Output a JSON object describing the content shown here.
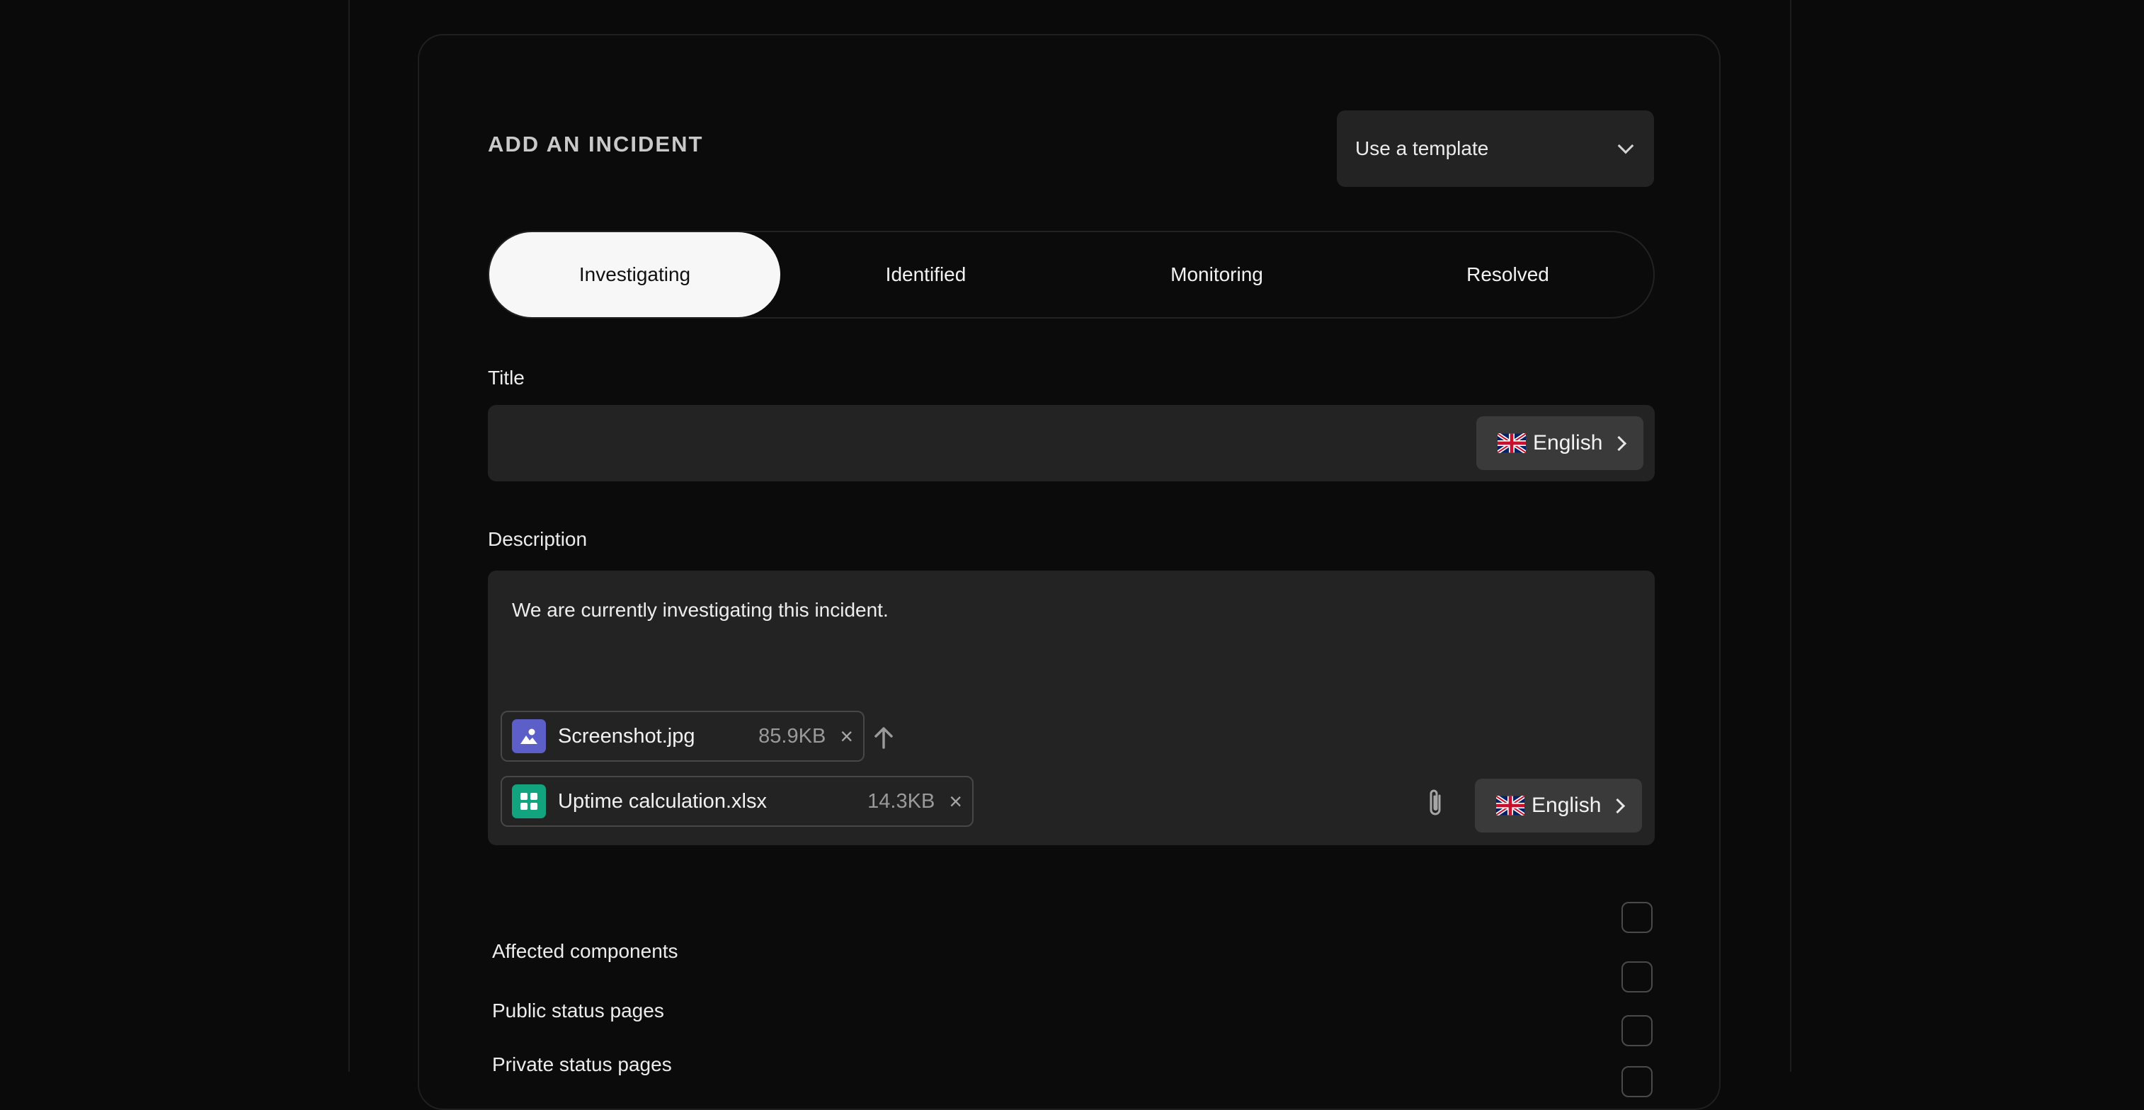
{
  "header": {
    "title": "ADD AN INCIDENT",
    "template_select_label": "Use a template"
  },
  "status_tabs": [
    {
      "label": "Investigating",
      "active": true
    },
    {
      "label": "Identified",
      "active": false
    },
    {
      "label": "Monitoring",
      "active": false
    },
    {
      "label": "Resolved",
      "active": false
    }
  ],
  "title_field": {
    "label": "Title",
    "value": "",
    "language": "English"
  },
  "description_field": {
    "label": "Description",
    "value": "We are currently investigating this incident.",
    "language": "English",
    "attachments": [
      {
        "name": "Screenshot.jpg",
        "size": "85.9KB",
        "icon": "image-file-icon",
        "icon_color": "#5b5fc7"
      },
      {
        "name": "Uptime calculation.xlsx",
        "size": "14.3KB",
        "icon": "spreadsheet-file-icon",
        "icon_color": "#12a37f"
      }
    ]
  },
  "options": [
    {
      "label": "Affected components",
      "checked": false
    },
    {
      "label": "Public status pages",
      "checked": false
    },
    {
      "label": "Private status pages",
      "checked": false
    }
  ],
  "colors": {
    "background": "#0a0a0a",
    "field": "#232323",
    "active_tab": "#f7f7f7"
  }
}
